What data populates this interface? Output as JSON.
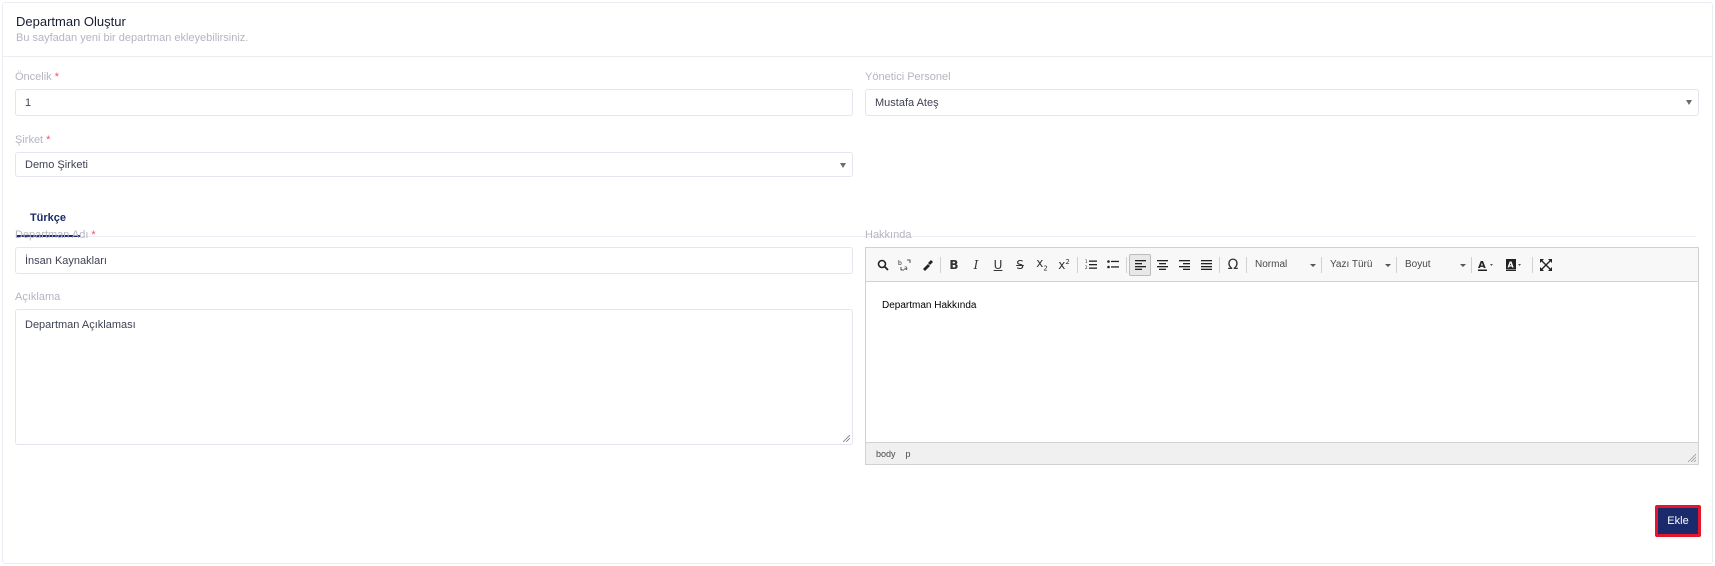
{
  "header": {
    "title": "Departman Oluştur",
    "subtitle": "Bu sayfadan yeni bir departman ekleyebilirsiniz."
  },
  "form": {
    "priority": {
      "label": "Öncelik",
      "required_mark": "*",
      "value": "1"
    },
    "manager": {
      "label": "Yönetici Personel",
      "value": "Mustafa Ateş"
    },
    "company": {
      "label": "Şirket",
      "required_mark": "*",
      "value": "Demo Şirketi"
    },
    "tabs": [
      {
        "label": "Türkçe",
        "active": true
      }
    ],
    "department_name": {
      "label": "Departman Adı",
      "required_mark": "*",
      "value": "İnsan Kaynakları"
    },
    "description": {
      "label": "Açıklama",
      "value": "Departman Açıklaması"
    },
    "about": {
      "label": "Hakkında",
      "content": "Departman Hakkında",
      "toolbar": {
        "format_combo": "Normal",
        "font_combo": "Yazı Türü",
        "size_combo": "Boyut"
      },
      "path": [
        "body",
        "p"
      ]
    },
    "submit_label": "Ekle"
  },
  "colors": {
    "primary": "#1b2a6b",
    "required": "#f64e60",
    "highlight_border": "#e5152c"
  }
}
